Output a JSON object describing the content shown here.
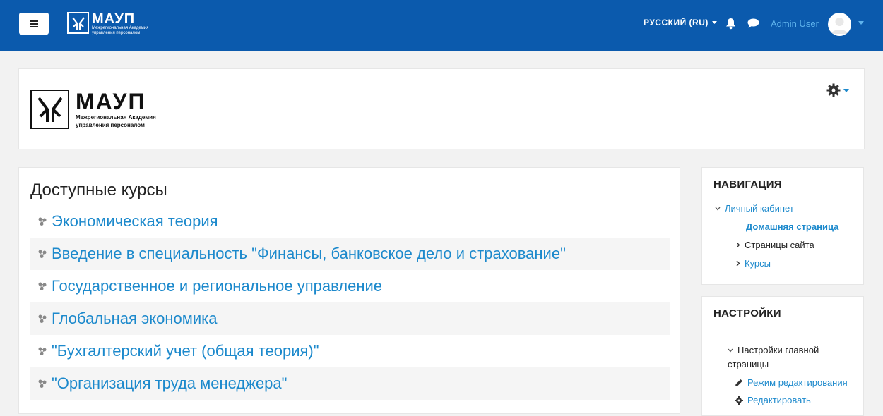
{
  "topbar": {
    "brand_title": "МАУП",
    "brand_sub_1": "Межрегиональная Академия",
    "brand_sub_2": "управления персоналом",
    "language": "РУССКИЙ (RU)",
    "username": "Admin User"
  },
  "header": {
    "logo_title": "МАУП",
    "logo_sub_1": "Межрегиональная Академия",
    "logo_sub_2": "управления персоналом"
  },
  "main": {
    "title": "Доступные курсы",
    "courses": [
      "Экономическая теория",
      "Введение в специальность \"Финансы, банковское дело и страхование\"",
      "Государственное и региональное управление",
      "Глобальная экономика",
      "\"Бухгалтерский учет (общая теория)\"",
      "\"Организация труда менеджера\""
    ]
  },
  "navigation": {
    "title": "НАВИГАЦИЯ",
    "my_cabinet": "Личный кабинет",
    "home": "Домашняя страница",
    "site_pages": "Страницы сайта",
    "courses": "Курсы"
  },
  "settings": {
    "title": "НАСТРОЙКИ",
    "home_settings_1": "Настройки главной",
    "home_settings_2": "страницы",
    "edit_mode": "Режим редактирования",
    "edit": "Редактировать"
  },
  "colors": {
    "topbar": "#0b5aad",
    "link": "#1c89cc",
    "username": "#5fb3ec"
  }
}
